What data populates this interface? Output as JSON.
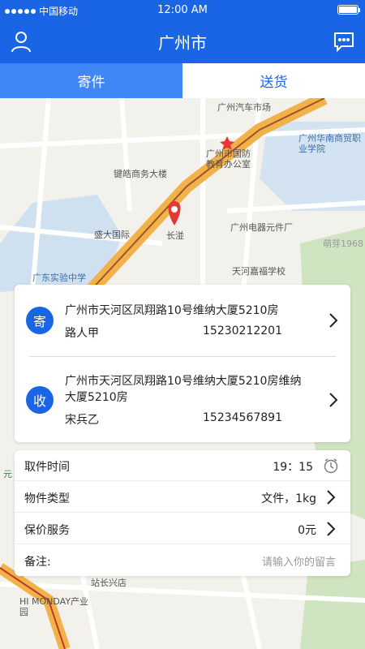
{
  "status_bar": {
    "carrier": "中国移动",
    "time": "12:00 AM"
  },
  "nav": {
    "title": "广州市",
    "left_icon": "user-icon",
    "right_icon": "message-icon"
  },
  "tabs": [
    {
      "label": "寄件",
      "active": true
    },
    {
      "label": "送货",
      "active": false
    }
  ],
  "map": {
    "labels": [
      "广州汽车市场",
      "广州华南商贸职业学院",
      "广州市国防教育办公室",
      "键皓商务大楼",
      "盛大国际",
      "长湴",
      "广州电器元件厂",
      "萌芽1968",
      "天河嘉福学校",
      "广东实验中学",
      "HI MONDAY产业园",
      "站长兴店",
      "元"
    ],
    "colors": {
      "road": "#f2b24a",
      "water": "#cfe0f0",
      "green": "#cfe4c0",
      "pin": "#e53935"
    }
  },
  "sender": {
    "badge": "寄",
    "address": "广州市天河区凤翔路10号维纳大厦5210房",
    "name": "路人甲",
    "phone": "15230212201"
  },
  "receiver": {
    "badge": "收",
    "address": "广州市天河区凤翔路10号维纳大厦5210房维纳大厦5210房",
    "name": "宋兵乙",
    "phone": "15234567891"
  },
  "form": {
    "pickup_time": {
      "label": "取件时间",
      "value": "19：15",
      "icon": "clock-icon"
    },
    "item_type": {
      "label": "物件类型",
      "value": "文件，1kg"
    },
    "insurance": {
      "label": "保价服务",
      "value": "0元"
    },
    "remark": {
      "label": "备注:",
      "placeholder": "请输入你的留言"
    }
  },
  "theme": {
    "primary": "#1a64e6",
    "tab_active": "#3f86f7"
  }
}
